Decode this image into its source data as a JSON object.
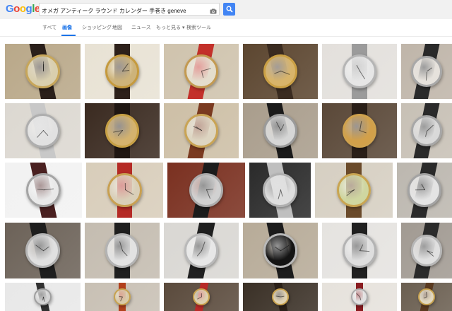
{
  "search": {
    "query": "オメガ アンティーク ラウンド カレンダー 手巻き geneve"
  },
  "logo": {
    "letters": [
      "G",
      "o",
      "o",
      "g",
      "l",
      "e"
    ],
    "colors": [
      "#4285f4",
      "#ea4335",
      "#fbbc05",
      "#4285f4",
      "#34a853",
      "#ea4335"
    ]
  },
  "tabs": [
    {
      "label": "すべて",
      "active": false
    },
    {
      "label": "画像",
      "active": true
    },
    {
      "label": "ショッピング",
      "active": false
    },
    {
      "label": "地図",
      "active": false
    },
    {
      "label": "ニュース",
      "active": false
    },
    {
      "label": "もっと見る ▾",
      "active": false
    },
    {
      "label": "検索ツール",
      "active": false
    }
  ],
  "icons": {
    "camera": "camera-icon",
    "search": "search-icon"
  },
  "results": [
    {
      "bg": "#b9a889",
      "dial": "#d9cfae",
      "bezel": "#c7a65a",
      "strap": "#2a1f1a"
    },
    {
      "bg": "#e8e2d4",
      "dial": "#cdb37a",
      "bezel": "#c59a3e",
      "strap": "#2d201a"
    },
    {
      "bg": "#cfc3ad",
      "dial": "#e4ddcd",
      "bezel": "#c39a52",
      "strap": "#c3302a"
    },
    {
      "bg": "#5c4630",
      "dial": "#d8b46a",
      "bezel": "#caa045",
      "strap": "#3a2b20"
    },
    {
      "bg": "#e3e0dc",
      "dial": "#e6e6e6",
      "bezel": "#b5b5b5",
      "strap": "#9b9b9b"
    },
    {
      "bg": "#bfb5a9",
      "dial": "#e6e2dc",
      "bezel": "#a8a8a8",
      "strap": "#2a2a2a"
    },
    {
      "bg": "#dcd8d1",
      "dial": "#e1e1e1",
      "bezel": "#aeaeae",
      "strap": "#c8c8c8"
    },
    {
      "bg": "#3a2a20",
      "dial": "#d4b26e",
      "bezel": "#c7a045",
      "strap": "#1f1612"
    },
    {
      "bg": "#cdbfa6",
      "dial": "#ddd5c1",
      "bezel": "#c9a455",
      "strap": "#7a3a20"
    },
    {
      "bg": "#a99d8c",
      "dial": "#d6d6d6",
      "bezel": "#9a9a9a",
      "strap": "#1a1a1a"
    },
    {
      "bg": "#5a4838",
      "dial": "#d2a04a",
      "bezel": "#cfa24e",
      "strap": "#2a1f18"
    },
    {
      "bg": "#c7c0b5",
      "dial": "#d9d9d9",
      "bezel": "#a7a7a7",
      "strap": "#2a2a2a"
    },
    {
      "bg": "#f2f2f2",
      "dial": "#e9e9e9",
      "bezel": "#a5a5a5",
      "strap": "#4a2020"
    },
    {
      "bg": "#d8cdba",
      "dial": "#d9cfb8",
      "bezel": "#c8a052",
      "strap": "#b52a25"
    },
    {
      "bg": "#7a3020",
      "dial": "#d1d1d1",
      "bezel": "#ababab",
      "strap": "#1c1c1c"
    },
    {
      "bg": "#2a2a2a",
      "dial": "#dedede",
      "bezel": "#b0b0b0",
      "strap": "#bfbfbf"
    },
    {
      "bg": "#d6cfc2",
      "dial": "#cfd6a0",
      "bezel": "#c9a552",
      "strap": "#6a4a2a"
    },
    {
      "bg": "#bcb7af",
      "dial": "#e4e4e4",
      "bezel": "#a3a3a3",
      "strap": "#2a2a2a"
    },
    {
      "bg": "#6c6258",
      "dial": "#e0e0e0",
      "bezel": "#b5b5b5",
      "strap": "#1e1e1e"
    },
    {
      "bg": "#c4bcb0",
      "dial": "#e2e2e2",
      "bezel": "#b3b3b3",
      "strap": "#1f1f1f"
    },
    {
      "bg": "#d9d7d3",
      "dial": "#e7e7e7",
      "bezel": "#b9b9b9",
      "strap": "#202020"
    },
    {
      "bg": "#b7ab98",
      "dial": "#141414",
      "bezel": "#b8b8b8",
      "strap": "#1c1c1c"
    },
    {
      "bg": "#e5e3e0",
      "dial": "#dedede",
      "bezel": "#b3b3b3",
      "strap": "#202020"
    },
    {
      "bg": "#a19a92",
      "dial": "#e0e0e0",
      "bezel": "#b7b7b7",
      "strap": "#2b2b2b"
    },
    {
      "bg": "#e8e8e8",
      "dial": "#d4d4d4",
      "bezel": "#9e9e9e",
      "strap": "#303030"
    },
    {
      "bg": "#c8c0b4",
      "dial": "#d8c9a8",
      "bezel": "#c7a24e",
      "strap": "#b2401c"
    },
    {
      "bg": "#5a4a3c",
      "dial": "#ddd0b0",
      "bezel": "#c9a24e",
      "strap": "#b82a28"
    },
    {
      "bg": "#3a3026",
      "dial": "#e0d2b2",
      "bezel": "#c9a24e",
      "strap": "#2a2018"
    },
    {
      "bg": "#e6e2dc",
      "dial": "#e2e2e2",
      "bezel": "#aaaaaa",
      "strap": "#8a1c20"
    },
    {
      "bg": "#6a5e50",
      "dial": "#e2d8c0",
      "bezel": "#c7a24e",
      "strap": "#5a3a20"
    }
  ]
}
